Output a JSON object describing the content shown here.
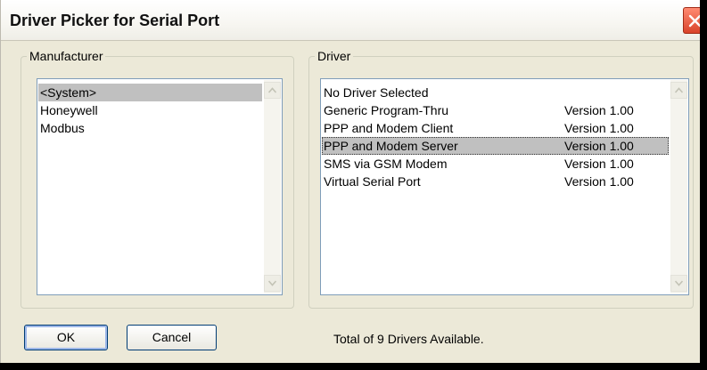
{
  "window": {
    "title": "Driver Picker for Serial Port"
  },
  "manufacturer": {
    "label": "Manufacturer",
    "items": [
      "<System>",
      "Honeywell",
      "Modbus"
    ],
    "selected_index": 0
  },
  "driver": {
    "label": "Driver",
    "items": [
      {
        "name": "No Driver Selected",
        "version": ""
      },
      {
        "name": "Generic Program-Thru",
        "version": "Version 1.00"
      },
      {
        "name": "PPP and Modem Client",
        "version": "Version 1.00"
      },
      {
        "name": "PPP and Modem Server",
        "version": "Version 1.00"
      },
      {
        "name": "SMS via GSM Modem",
        "version": "Version 1.00"
      },
      {
        "name": "Virtual Serial Port",
        "version": "Version 1.00"
      }
    ],
    "selected_index": 3
  },
  "buttons": {
    "ok_label": "OK",
    "cancel_label": "Cancel"
  },
  "status_text": "Total of 9 Drivers Available.",
  "colors": {
    "selection": "#c0c0c0",
    "dialog_bg": "#ece9d8",
    "close_button": "#d9432a"
  },
  "icons": {
    "close": "close-icon",
    "scroll_up": "scroll-up-icon",
    "scroll_down": "scroll-down-icon"
  }
}
